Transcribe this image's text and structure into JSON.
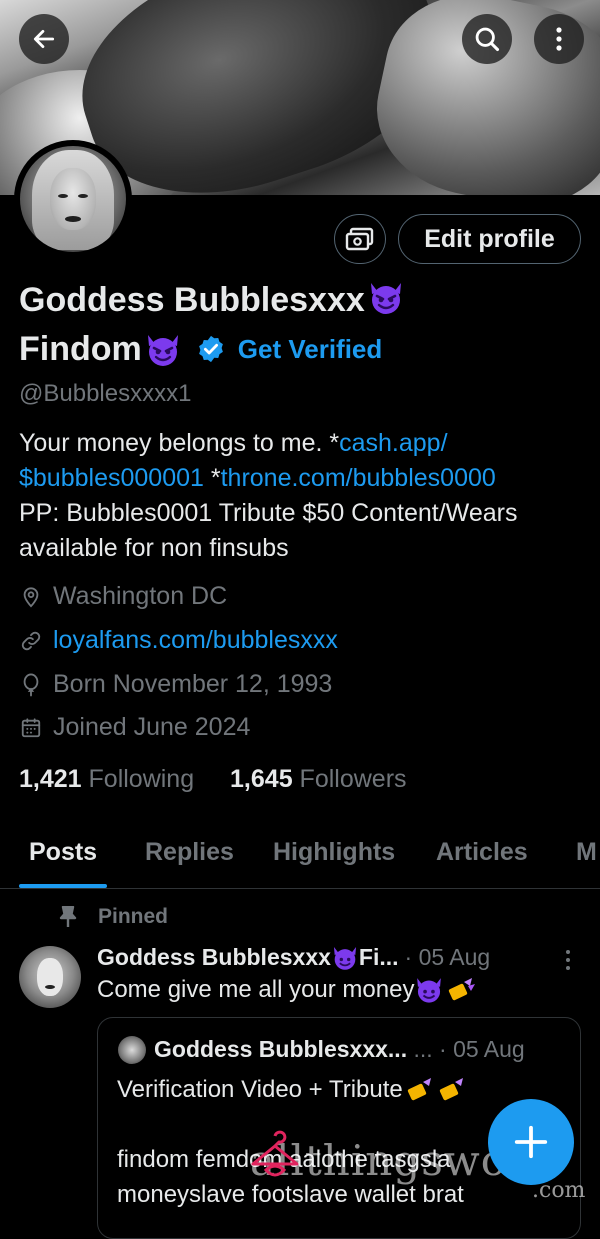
{
  "profile": {
    "name_line1": "Goddess Bubblesxxx",
    "name_line2": "Findom",
    "get_verified": "Get Verified",
    "handle": "@Bubblesxxxx1",
    "edit_profile": "Edit profile",
    "bio_line1_text": "Your money belongs to me.  *",
    "bio_line1_link": "cash.app/",
    "bio_line2_link1": "$bubbles000001",
    "bio_line2_text": " *",
    "bio_line2_link2": "throne.com/bubbles0000",
    "bio_line3": "PP: Bubbles0001 Tribute $50  Content/Wears",
    "bio_line4": "available for non finsubs",
    "location": "Washington DC",
    "website": "loyalfans.com/bubblesxxx",
    "born": "Born November 12, 1993",
    "joined": "Joined June 2024",
    "following_count": "1,421",
    "following_label": "Following",
    "followers_count": "1,645",
    "followers_label": "Followers"
  },
  "tabs": [
    "Posts",
    "Replies",
    "Highlights",
    "Articles",
    "M"
  ],
  "pinned_label": "Pinned",
  "post": {
    "author": "Goddess Bubblesxxx",
    "author_tail": "Fi...",
    "date": "· 05 Aug",
    "text": "Come give me all your money",
    "quote": {
      "author": "Goddess Bubblesxxx...",
      "ellipsis": "...",
      "date": "· 05 Aug",
      "line1": "Verification Video + Tribute",
      "line2": "findom femdom aalothe tasgsla",
      "line3": "moneyslave footslave wallet brat"
    }
  },
  "watermark": {
    "main": "allthingsworn",
    "com": ".com"
  },
  "colors": {
    "accent": "#1d9bf0",
    "text": "#e7e9ea",
    "muted": "#71767b",
    "devil": "#7c3aed"
  },
  "icons": [
    "back-arrow-icon",
    "search-icon",
    "more-vertical-icon",
    "money-icon",
    "verified-badge-icon",
    "location-icon",
    "link-icon",
    "balloon-icon",
    "calendar-icon",
    "pin-icon",
    "compose-plus-icon"
  ]
}
